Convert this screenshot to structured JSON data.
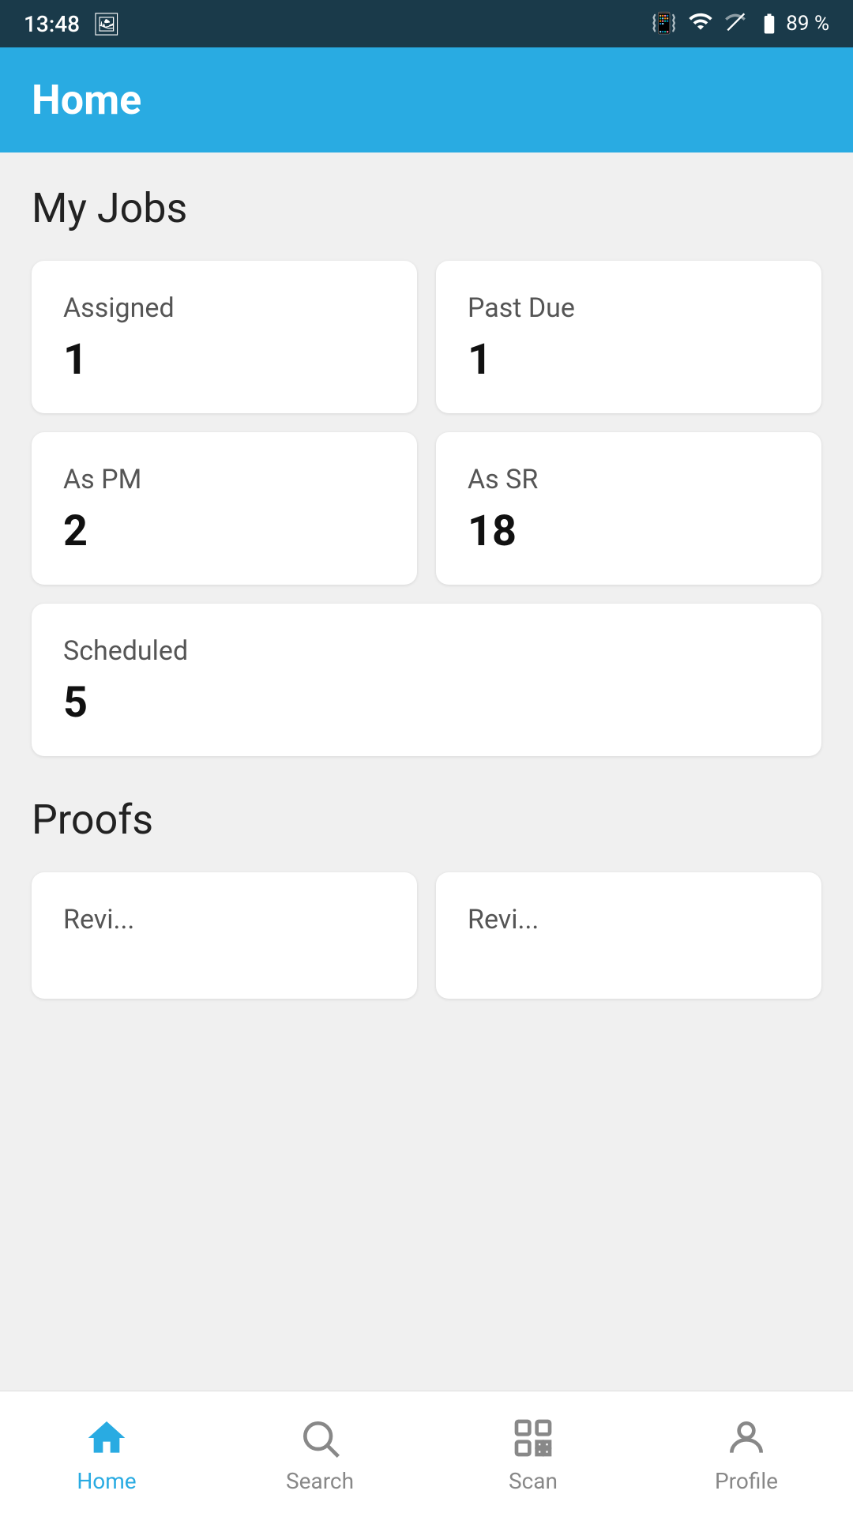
{
  "statusBar": {
    "time": "13:48",
    "battery": "89 %"
  },
  "header": {
    "title": "Home"
  },
  "myJobs": {
    "sectionTitle": "My Jobs",
    "cards": [
      {
        "label": "Assigned",
        "value": "1"
      },
      {
        "label": "Past Due",
        "value": "1"
      },
      {
        "label": "As PM",
        "value": "2"
      },
      {
        "label": "As SR",
        "value": "18"
      }
    ],
    "fullWidthCard": {
      "label": "Scheduled",
      "value": "5"
    }
  },
  "proofs": {
    "sectionTitle": "Proofs",
    "cards": [
      {
        "label": "Revi..."
      },
      {
        "label": "Revi..."
      }
    ]
  },
  "bottomNav": {
    "items": [
      {
        "label": "Home",
        "active": true
      },
      {
        "label": "Search",
        "active": false
      },
      {
        "label": "Scan",
        "active": false
      },
      {
        "label": "Profile",
        "active": false
      }
    ]
  }
}
